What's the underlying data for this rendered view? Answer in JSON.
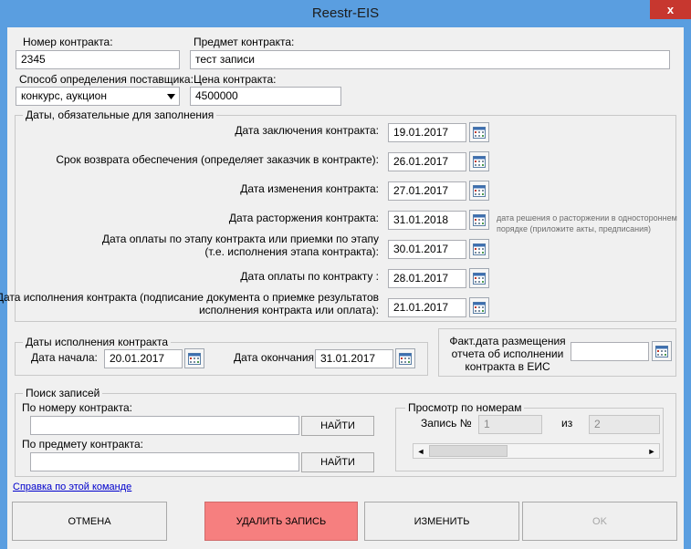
{
  "window": {
    "title": "Reestr-EIS",
    "close_glyph": "x"
  },
  "top": {
    "contract_number_label": "Номер контракта:",
    "contract_number_value": "2345",
    "subject_label": "Предмет контракта:",
    "subject_value": "тест записи",
    "method_label": "Способ определения поставщика:",
    "method_value": "конкурс, аукцион",
    "price_label": "Цена контракта:",
    "price_value": "4500000"
  },
  "dates": {
    "frame_title": "Даты, обязательные для заполнения",
    "rows": [
      {
        "label": "Дата заключения контракта:",
        "value": "19.01.2017"
      },
      {
        "label": "Срок возврата обеспечения (определяет заказчик в контракте):",
        "value": "26.01.2017"
      },
      {
        "label": "Дата изменения контракта:",
        "value": "27.01.2017"
      },
      {
        "label": "Дата расторжения контракта:",
        "value": "31.01.2018"
      },
      {
        "label_line1": "Дата оплаты по этапу контракта или приемки по этапу",
        "label_line2": "(т.е. исполнения этапа контракта):",
        "value": "30.01.2017"
      },
      {
        "label": "Дата оплаты по контракту :",
        "value": "28.01.2017"
      },
      {
        "label_line1": "Дата исполнения контракта (подписание документа о приемке результатов",
        "label_line2": "исполнения контракта или оплата):",
        "value": "21.01.2017"
      }
    ],
    "termination_note_line1": "дата решения о расторжении в одностороннем",
    "termination_note_line2": "порядке (приложите акты, предписания)"
  },
  "execution": {
    "frame_title": "Даты исполнения контракта",
    "start_label": "Дата начала:",
    "start_value": "20.01.2017",
    "end_label": "Дата окончания:",
    "end_value": "31.01.2017"
  },
  "report": {
    "label_line1": "Факт.дата размещения",
    "label_line2": "отчета об исполнении",
    "label_line3": "контракта в ЕИС",
    "value": ""
  },
  "search": {
    "frame_title": "Поиск записей",
    "by_number_label": "По номеру контракта:",
    "by_number_value": "",
    "by_subject_label": "По предмету контракта:",
    "by_subject_value": "",
    "find_label": "НАЙТИ"
  },
  "browse": {
    "frame_title": "Просмотр по номерам",
    "record_label": "Запись №",
    "record_value": "1",
    "of_label": "из",
    "total_value": "2",
    "scroll_left_glyph": "◄",
    "scroll_right_glyph": "►"
  },
  "help_link": "Справка по этой команде",
  "buttons": {
    "cancel": "ОТМЕНА",
    "delete": "УДАЛИТЬ ЗАПИСЬ",
    "edit": "ИЗМЕНИТЬ",
    "ok": "OK"
  },
  "colors": {
    "window_frame": "#5a9ee0",
    "client_bg": "#f0f0f0",
    "delete_button": "#f67f7f",
    "close_button": "#c7372f",
    "link": "#0000cc"
  },
  "icons": {
    "calendar": "calendar-icon",
    "combo_arrow": "chevron-down-icon",
    "close": "close-icon"
  }
}
